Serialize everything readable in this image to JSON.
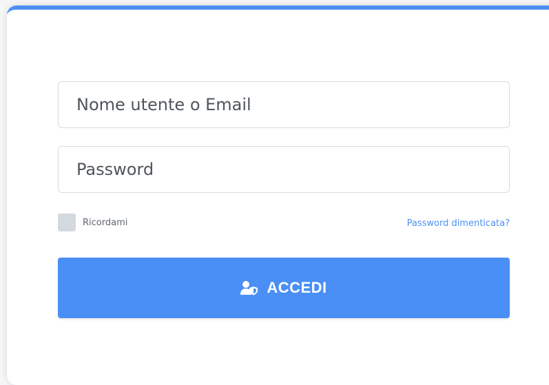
{
  "login": {
    "username_placeholder": "Nome utente o Email",
    "password_placeholder": "Password",
    "remember_label": "Ricordami",
    "forgot_link": "Password dimenticata?",
    "submit_label": "ACCEDI",
    "submit_icon": "user-shield-icon"
  },
  "colors": {
    "accent": "#4a8ff5",
    "checkbox": "#d3d9de",
    "text": "#4f555c"
  }
}
